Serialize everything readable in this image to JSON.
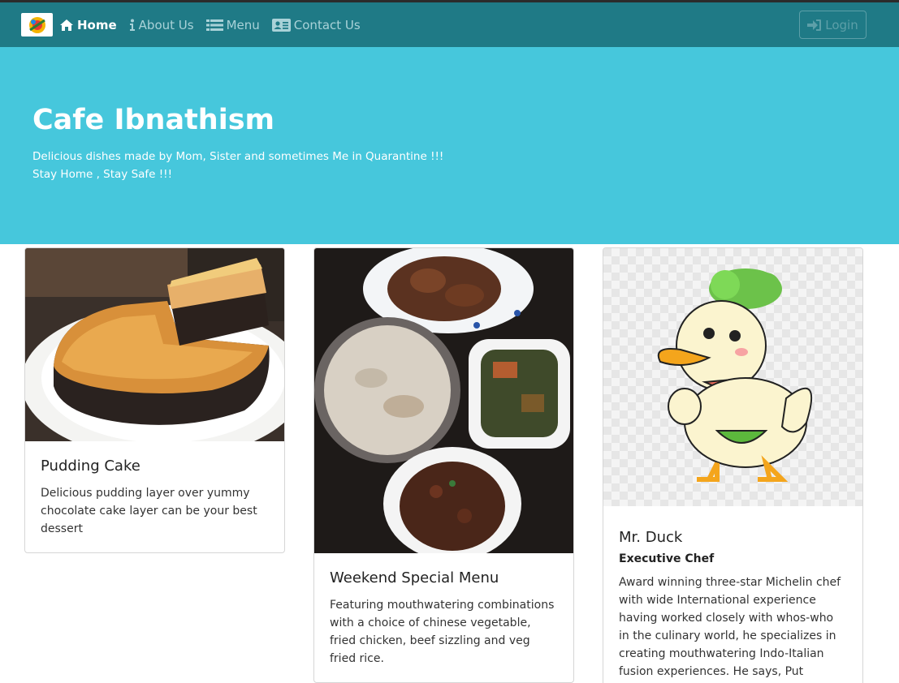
{
  "nav": {
    "items": [
      {
        "label": "Home",
        "icon": "home-icon",
        "active": true
      },
      {
        "label": "About Us",
        "icon": "info-icon",
        "active": false
      },
      {
        "label": "Menu",
        "icon": "list-icon",
        "active": false
      },
      {
        "label": "Contact Us",
        "icon": "address-card-icon",
        "active": false
      }
    ],
    "login_label": "Login",
    "colors": {
      "navbar": "#1f7a86",
      "active": "#ffffff",
      "inactive": "#a9d2d8"
    }
  },
  "hero": {
    "title": "Cafe Ibnathism",
    "line1": "Delicious dishes made by Mom, Sister and sometimes Me in Quarantine !!!",
    "line2": "Stay Home , Stay Safe !!!",
    "color": "#46c7dc"
  },
  "cards": [
    {
      "title": "Pudding Cake",
      "text": "Delicious pudding layer over yummy chocolate cake layer can be your best dessert"
    },
    {
      "title": "Weekend Special Menu",
      "text": "Featuring mouthwatering combinations with a choice of chinese vegetable, fried chicken, beef sizzling and veg fried rice."
    },
    {
      "title": "Mr. Duck",
      "subtitle": "Executive Chef",
      "text": "Award winning three-star Michelin chef with wide International experience having worked closely with whos-who in the culinary world, he specializes in creating mouthwatering Indo-Italian fusion experiences. He says, Put together the"
    }
  ]
}
